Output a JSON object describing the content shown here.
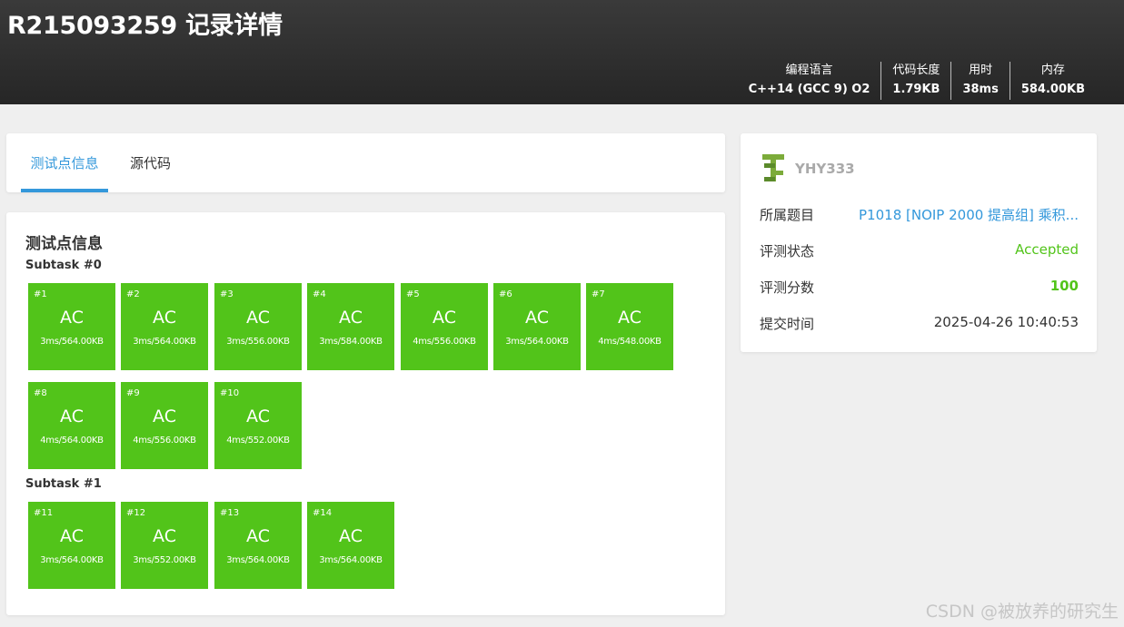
{
  "header": {
    "title": "R215093259 记录详情",
    "stats": [
      {
        "label": "编程语言",
        "value": "C++14 (GCC 9) O2"
      },
      {
        "label": "代码长度",
        "value": "1.79KB"
      },
      {
        "label": "用时",
        "value": "38ms"
      },
      {
        "label": "内存",
        "value": "584.00KB"
      }
    ]
  },
  "tabs": {
    "test_points": "测试点信息",
    "source_code": "源代码"
  },
  "main": {
    "section_title": "测试点信息",
    "subtasks": [
      {
        "label": "Subtask #0",
        "cases": [
          {
            "num": "#1",
            "status": "AC",
            "info": "3ms/564.00KB"
          },
          {
            "num": "#2",
            "status": "AC",
            "info": "3ms/564.00KB"
          },
          {
            "num": "#3",
            "status": "AC",
            "info": "3ms/556.00KB"
          },
          {
            "num": "#4",
            "status": "AC",
            "info": "3ms/584.00KB"
          },
          {
            "num": "#5",
            "status": "AC",
            "info": "4ms/556.00KB"
          },
          {
            "num": "#6",
            "status": "AC",
            "info": "3ms/564.00KB"
          },
          {
            "num": "#7",
            "status": "AC",
            "info": "4ms/548.00KB"
          },
          {
            "num": "#8",
            "status": "AC",
            "info": "4ms/564.00KB"
          },
          {
            "num": "#9",
            "status": "AC",
            "info": "4ms/556.00KB"
          },
          {
            "num": "#10",
            "status": "AC",
            "info": "4ms/552.00KB"
          }
        ]
      },
      {
        "label": "Subtask #1",
        "cases": [
          {
            "num": "#11",
            "status": "AC",
            "info": "3ms/564.00KB"
          },
          {
            "num": "#12",
            "status": "AC",
            "info": "3ms/552.00KB"
          },
          {
            "num": "#13",
            "status": "AC",
            "info": "3ms/564.00KB"
          },
          {
            "num": "#14",
            "status": "AC",
            "info": "3ms/564.00KB"
          }
        ]
      }
    ]
  },
  "info": {
    "username": "YHY333",
    "avatar_icon": "user-badge-icon",
    "rows": [
      {
        "label": "所属题目",
        "value": "P1018 [NOIP 2000 提高组] 乘积..."
      },
      {
        "label": "评测状态",
        "value": "Accepted"
      },
      {
        "label": "评测分数",
        "value": "100"
      },
      {
        "label": "提交时间",
        "value": "2025-04-26 10:40:53"
      }
    ]
  },
  "watermark": "CSDN @被放养的研究生",
  "colors": {
    "accent": "#3498db",
    "ac_green": "#52c41a",
    "header_bg": "#2d2d2d",
    "page_bg": "#efefef",
    "username_gray": "#aaaaaa"
  }
}
